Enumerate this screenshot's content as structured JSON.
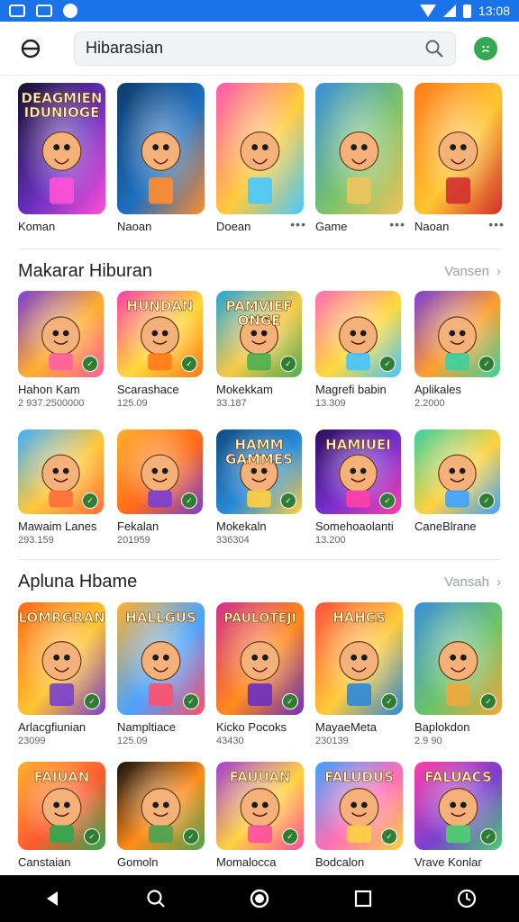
{
  "status": {
    "time": "13:08"
  },
  "search": {
    "value": "Hibarasian"
  },
  "top_row": [
    {
      "name": "Koman",
      "art_text": "DEAGMIEN IDUNIOGE",
      "colors": [
        "#12122e",
        "#6b2fbf",
        "#ff4fd8"
      ]
    },
    {
      "name": "Naoan",
      "art_text": "",
      "colors": [
        "#0c3b6a",
        "#1f6fbf",
        "#ff8c2e"
      ]
    },
    {
      "name": "Doean",
      "art_text": "",
      "colors": [
        "#ff5ab1",
        "#ffcb3a",
        "#49c9ff"
      ]
    },
    {
      "name": "Game",
      "art_text": "",
      "colors": [
        "#3a8fd9",
        "#7bc36b",
        "#f0c35a"
      ]
    },
    {
      "name": "Naoan",
      "art_text": "",
      "colors": [
        "#ff7a1a",
        "#ffc531",
        "#d22f2f"
      ]
    }
  ],
  "sections": [
    {
      "title": "Makarar Hiburan",
      "more": "Vansen",
      "rows": [
        [
          {
            "name": "Hahon Kam",
            "meta": "2 937.2500000",
            "art_text": "",
            "colors": [
              "#7b3fd6",
              "#ffb02e",
              "#ff5f9e"
            ]
          },
          {
            "name": "Scarashace",
            "meta": "125.09",
            "art_text": "HUNDAN",
            "colors": [
              "#ff3fa8",
              "#ffd83a",
              "#ff7a1a"
            ]
          },
          {
            "name": "Mokekkam",
            "meta": "33.187",
            "art_text": "PAMVIEF ONGE",
            "colors": [
              "#23a6d5",
              "#f7c948",
              "#4caf50"
            ]
          },
          {
            "name": "Magrefi babin",
            "meta": "13.309",
            "art_text": "",
            "colors": [
              "#ff6fb5",
              "#ffd93b",
              "#44c4ff"
            ]
          },
          {
            "name": "Aplikales",
            "meta": "2.2000",
            "art_text": "",
            "colors": [
              "#7c3fd8",
              "#ff9f2e",
              "#3ad29f"
            ]
          }
        ],
        [
          {
            "name": "Mawaim Lanes",
            "meta": "293.159",
            "art_text": "",
            "colors": [
              "#3fb0ff",
              "#ffc83a",
              "#ff6f3a"
            ]
          },
          {
            "name": "Fekalan",
            "meta": "201959",
            "art_text": "",
            "colors": [
              "#ffb02e",
              "#ff6a1a",
              "#7a3fcf"
            ]
          },
          {
            "name": "Mokekaln",
            "meta": "336304",
            "art_text": "HAMM GAMMES",
            "colors": [
              "#0f4c81",
              "#2b8ad8",
              "#ffd23f"
            ]
          },
          {
            "name": "Somehoaolanti",
            "meta": "13.200",
            "art_text": "HAMIUEI",
            "colors": [
              "#2b0f5a",
              "#7a2fd0",
              "#ff3fa8"
            ]
          },
          {
            "name": "CaneBlrane",
            "meta": "",
            "art_text": "",
            "colors": [
              "#3ad29f",
              "#ffd23f",
              "#3fa2ff"
            ]
          }
        ]
      ]
    },
    {
      "title": "Apluna Hbame",
      "more": "Vansah",
      "rows": [
        [
          {
            "name": "Arlacgfiunian",
            "meta": "23099",
            "art_text": "LOMRGRAN",
            "colors": [
              "#ff6a1a",
              "#ffc531",
              "#7a3fcf"
            ]
          },
          {
            "name": "Nampltiace",
            "meta": "125.09",
            "art_text": "HALLGUS",
            "colors": [
              "#ffb02e",
              "#4aa3ff",
              "#ff4f6a"
            ]
          },
          {
            "name": "Kicko Pocoks",
            "meta": "43430",
            "art_text": "PAULOTEJI",
            "colors": [
              "#d22f8a",
              "#ff8a1a",
              "#6b2fbf"
            ]
          },
          {
            "name": "MayaeMeta",
            "meta": "230139",
            "art_text": "HAHCS",
            "colors": [
              "#ff4f3a",
              "#ffcb3a",
              "#2b8ad8"
            ]
          },
          {
            "name": "Baplokdon",
            "meta": "2.9 90",
            "art_text": "",
            "colors": [
              "#3a8fd9",
              "#6bc36b",
              "#f0a83a"
            ]
          }
        ],
        [
          {
            "name": "Canstaian",
            "meta": "",
            "art_text": "FAIUAN",
            "colors": [
              "#ffb02e",
              "#ff5a2e",
              "#2fa84f"
            ]
          },
          {
            "name": "Gomoln",
            "meta": "",
            "art_text": "",
            "colors": [
              "#111111",
              "#ff8c1a",
              "#4aa34f"
            ]
          },
          {
            "name": "Momalocca",
            "meta": "",
            "art_text": "FAUUAN",
            "colors": [
              "#a13fd6",
              "#ffd23f",
              "#ff4fa0"
            ]
          },
          {
            "name": "Bodcalon",
            "meta": "",
            "art_text": "FALUDUS",
            "colors": [
              "#3fa2ff",
              "#ff6fb5",
              "#ffd23f"
            ]
          },
          {
            "name": "Vrave Konlar",
            "meta": "",
            "art_text": "FALUACS",
            "colors": [
              "#ff3fa8",
              "#7a3fcf",
              "#4ad06b"
            ]
          }
        ]
      ]
    }
  ]
}
